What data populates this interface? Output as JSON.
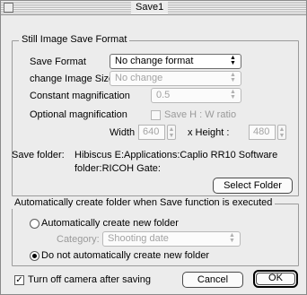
{
  "window": {
    "title": "Save1"
  },
  "still_image_group": {
    "legend": "Still Image Save Format",
    "save_format_label": "Save Format",
    "save_format_value": "No change format",
    "change_size_label": "change Image Size",
    "change_size_value": "No change",
    "constant_mag_label": "Constant magnification",
    "constant_mag_value": "0.5",
    "optional_mag_label": "Optional magnification",
    "ratio_checkbox_label": "Save H : W ratio",
    "width_label": "Width",
    "width_value": "640",
    "height_label": "x Height :",
    "height_value": "480"
  },
  "save_folder": {
    "label": "Save folder:",
    "path_line1": "Hibiscus E:Applications:Caplio RR10 Software",
    "path_line2": "folder:RICOH Gate:",
    "select_button": "Select Folder"
  },
  "auto_folder_group": {
    "legend": "Automatically create folder when Save function is executed",
    "auto_create_label": "Automatically create new folder",
    "category_label": "Category:",
    "category_value": "Shooting date",
    "no_auto_create_label": "Do not automatically create new folder"
  },
  "footer": {
    "turn_off_label": "Turn off camera after saving",
    "turn_off_checked": true,
    "cancel_button": "Cancel",
    "ok_button": "OK"
  },
  "icons": {
    "popup_arrows": "up-down-arrows-icon",
    "checkmark": "checkmark-icon"
  }
}
